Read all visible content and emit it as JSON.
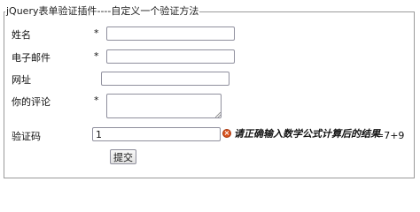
{
  "form": {
    "legend": "jQuery表单验证插件----自定义一个验证方法",
    "required_mark": "*",
    "fields": {
      "name": {
        "label": "姓名",
        "value": ""
      },
      "email": {
        "label": "电子邮件",
        "value": ""
      },
      "url": {
        "label": "网址",
        "value": ""
      },
      "comment": {
        "label": "你的评论",
        "value": ""
      },
      "captcha": {
        "label": "验证码",
        "value": "1",
        "question": "=7+9"
      }
    },
    "error_message": "请正确输入数学公式计算后的结果",
    "submit_label": "提交"
  },
  "colors": {
    "error_icon": "#d9531e",
    "border": "#9a9a9a"
  },
  "icons": {
    "error": "error-x-icon"
  }
}
